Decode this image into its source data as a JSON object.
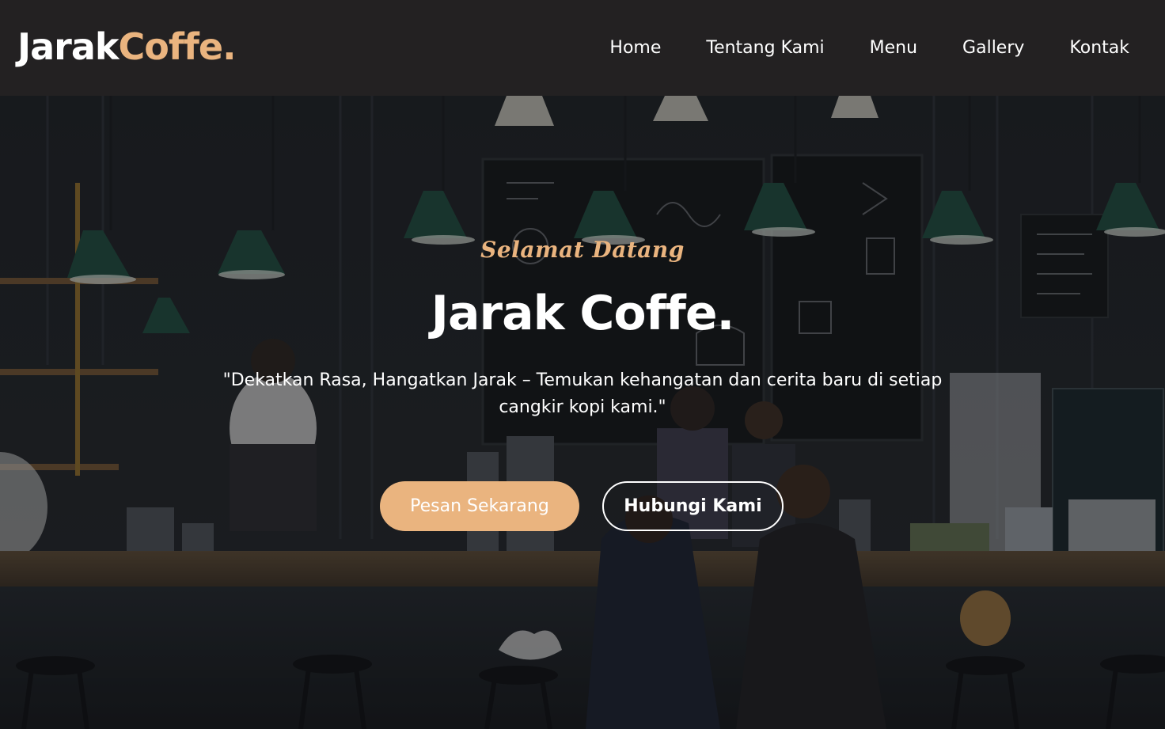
{
  "brand": {
    "name_primary": "Jarak",
    "name_accent": "Coffe."
  },
  "nav": {
    "items": [
      {
        "label": "Home"
      },
      {
        "label": "Tentang Kami"
      },
      {
        "label": "Menu"
      },
      {
        "label": "Gallery"
      },
      {
        "label": "Kontak"
      }
    ]
  },
  "hero": {
    "subtitle": "Selamat Datang",
    "title": "Jarak Coffe.",
    "description": "\"Dekatkan Rasa, Hangatkan Jarak – Temukan kehangatan dan cerita baru di setiap cangkir kopi kami.\"",
    "primary_button": "Pesan Sekarang",
    "secondary_button": "Hubungi Kami",
    "background_image": "coffee-shop-interior-photo"
  },
  "colors": {
    "accent": "#eab47f",
    "navbar_bg": "#232122",
    "text": "#ffffff"
  }
}
